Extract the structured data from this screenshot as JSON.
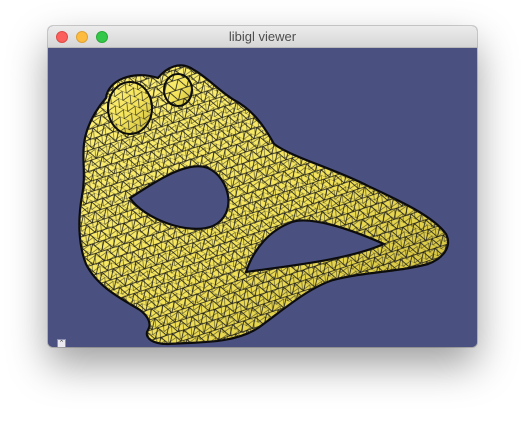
{
  "window": {
    "title": "libigl viewer"
  },
  "viewport": {
    "background_color": "#4a5080",
    "mesh_fill_color": "#f3e35a",
    "wireframe_color": "#111111"
  },
  "overlay_buttons": [
    {
      "icon": "chevron-up-icon",
      "glyph": "⌃"
    },
    {
      "icon": "help-icon",
      "glyph": "?"
    }
  ]
}
